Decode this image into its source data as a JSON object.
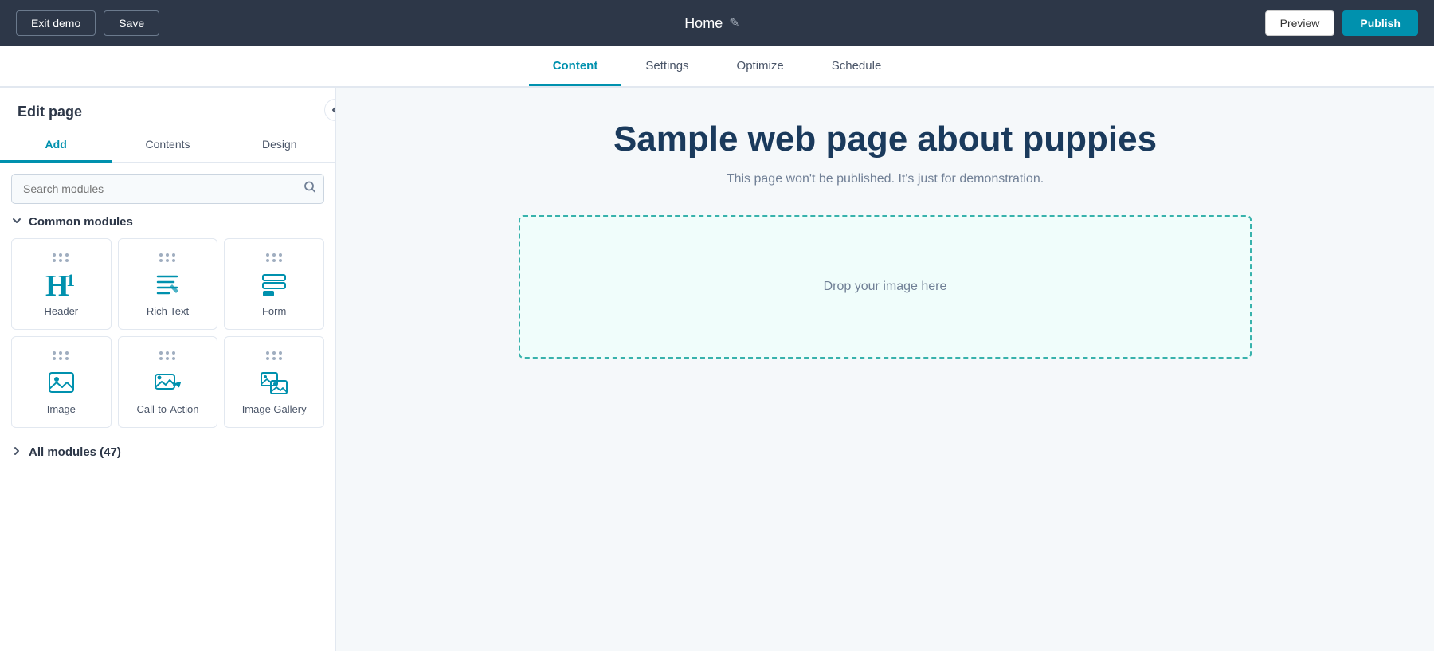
{
  "topbar": {
    "exit_demo_label": "Exit demo",
    "save_label": "Save",
    "page_title": "Home",
    "edit_icon": "✎",
    "publish_label": "Publish",
    "preview_label": "Preview"
  },
  "nav": {
    "tabs": [
      {
        "id": "content",
        "label": "Content",
        "active": true
      },
      {
        "id": "settings",
        "label": "Settings",
        "active": false
      },
      {
        "id": "optimize",
        "label": "Optimize",
        "active": false
      },
      {
        "id": "schedule",
        "label": "Schedule",
        "active": false
      }
    ]
  },
  "sidebar": {
    "header": "Edit page",
    "inner_tabs": [
      {
        "id": "add",
        "label": "Add",
        "active": true
      },
      {
        "id": "contents",
        "label": "Contents",
        "active": false
      },
      {
        "id": "design",
        "label": "Design",
        "active": false
      }
    ],
    "search_placeholder": "Search modules",
    "common_modules_title": "Common modules",
    "modules": [
      {
        "id": "header",
        "label": "Header",
        "icon": "header"
      },
      {
        "id": "rich-text",
        "label": "Rich Text",
        "icon": "richtext"
      },
      {
        "id": "form",
        "label": "Form",
        "icon": "form"
      },
      {
        "id": "image",
        "label": "Image",
        "icon": "image"
      },
      {
        "id": "call-to-action",
        "label": "Call-to-Action",
        "icon": "cta"
      },
      {
        "id": "image-gallery",
        "label": "Image Gallery",
        "icon": "gallery"
      }
    ],
    "all_modules_label": "All modules (47)"
  },
  "canvas": {
    "heading": "Sample web page about puppies",
    "subtext": "This page won't be published. It's just for demonstration.",
    "drop_zone_text": "Drop your image here"
  }
}
